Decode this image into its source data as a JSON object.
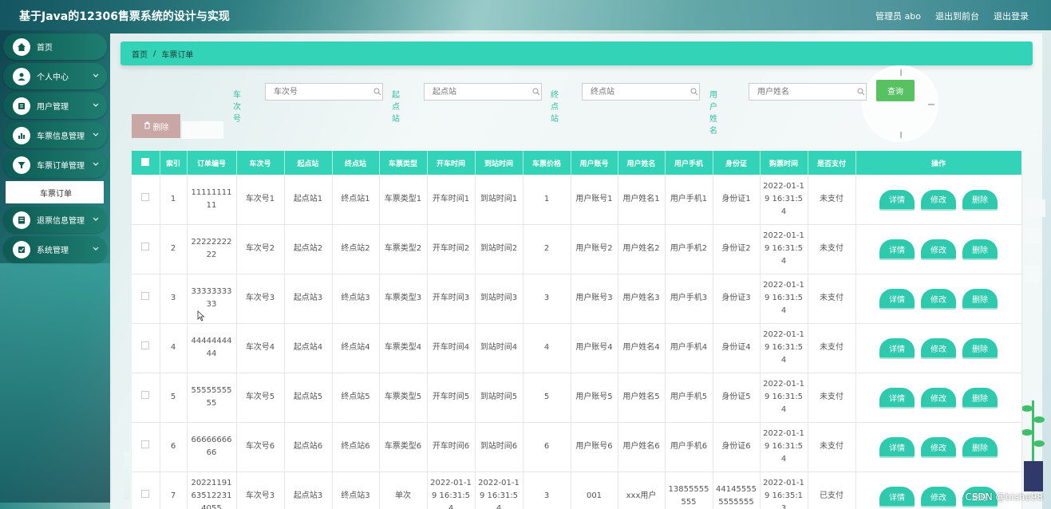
{
  "header": {
    "title": "基于Java的12306售票系统的设计与实现",
    "admin_label": "管理员 abo",
    "to_frontend": "退出到前台",
    "logout": "退出登录"
  },
  "sidebar": {
    "items": [
      {
        "label": "首页",
        "icon": "home-icon",
        "has_children": false
      },
      {
        "label": "个人中心",
        "icon": "user-icon",
        "has_children": true
      },
      {
        "label": "用户管理",
        "icon": "user-manage-icon",
        "has_children": true
      },
      {
        "label": "车票信息管理",
        "icon": "chart-icon",
        "has_children": true
      },
      {
        "label": "车票订单管理",
        "icon": "filter-icon",
        "has_children": true,
        "expanded": true
      },
      {
        "label": "退票信息管理",
        "icon": "document-icon",
        "has_children": true
      },
      {
        "label": "系统管理",
        "icon": "settings-icon",
        "has_children": true
      }
    ],
    "active_submenu": "车票订单"
  },
  "breadcrumb": {
    "home": "首页",
    "separator": "/",
    "current": "车票订单"
  },
  "search": {
    "fields": [
      {
        "label": "车次号",
        "placeholder": "车次号"
      },
      {
        "label": "起点站",
        "placeholder": "起点站"
      },
      {
        "label": "终点站",
        "placeholder": "终点站"
      },
      {
        "label": "用户姓名",
        "placeholder": "用户姓名"
      }
    ],
    "query_label": "查询"
  },
  "toolbar": {
    "delete_label": "删除"
  },
  "table": {
    "columns": [
      "索引",
      "订单编号",
      "车次号",
      "起点站",
      "终点站",
      "车票类型",
      "开车时间",
      "到站时间",
      "车票价格",
      "用户账号",
      "用户姓名",
      "用户手机",
      "身份证",
      "购票时间",
      "是否支付",
      "操作"
    ],
    "actions": {
      "detail": "详情",
      "edit": "修改",
      "delete": "删除"
    },
    "rows": [
      [
        "1",
        "1111111111",
        "车次号1",
        "起点站1",
        "终点站1",
        "车票类型1",
        "开车时间1",
        "到站时间1",
        "1",
        "用户账号1",
        "用户姓名1",
        "用户手机1",
        "身份证1",
        "2022-01-19 16:31:54",
        "未支付"
      ],
      [
        "2",
        "2222222222",
        "车次号2",
        "起点站2",
        "终点站2",
        "车票类型2",
        "开车时间2",
        "到站时间2",
        "2",
        "用户账号2",
        "用户姓名2",
        "用户手机2",
        "身份证2",
        "2022-01-19 16:31:54",
        "未支付"
      ],
      [
        "3",
        "3333333333",
        "车次号3",
        "起点站3",
        "终点站3",
        "车票类型3",
        "开车时间3",
        "到站时间3",
        "3",
        "用户账号3",
        "用户姓名3",
        "用户手机3",
        "身份证3",
        "2022-01-19 16:31:54",
        "未支付"
      ],
      [
        "4",
        "4444444444",
        "车次号4",
        "起点站4",
        "终点站4",
        "车票类型4",
        "开车时间4",
        "到站时间4",
        "4",
        "用户账号4",
        "用户姓名4",
        "用户手机4",
        "身份证4",
        "2022-01-19 16:31:54",
        "未支付"
      ],
      [
        "5",
        "5555555555",
        "车次号5",
        "起点站5",
        "终点站5",
        "车票类型5",
        "开车时间5",
        "到站时间5",
        "5",
        "用户账号5",
        "用户姓名5",
        "用户手机5",
        "身份证5",
        "2022-01-19 16:31:54",
        "未支付"
      ],
      [
        "6",
        "6666666666",
        "车次号6",
        "起点站6",
        "终点站6",
        "车票类型6",
        "开车时间6",
        "到站时间6",
        "6",
        "用户账号6",
        "用户姓名6",
        "用户手机6",
        "身份证6",
        "2022-01-19 16:31:54",
        "未支付"
      ],
      [
        "7",
        "20221191635122314055",
        "车次号3",
        "起点站3",
        "终点站3",
        "单次",
        "2022-01-19 16:31:54",
        "2022-01-19 16:31:54",
        "3",
        "001",
        "xxx用户",
        "13855555555",
        "441455555555555",
        "2022-01-19 16:35:13",
        "已支付"
      ]
    ]
  },
  "watermark": "CSDN @bishe98",
  "colors": {
    "accent": "#33d3b7",
    "sidebar": "#0d5b54",
    "query": "#58c262",
    "delete": "#c9a7a4"
  }
}
